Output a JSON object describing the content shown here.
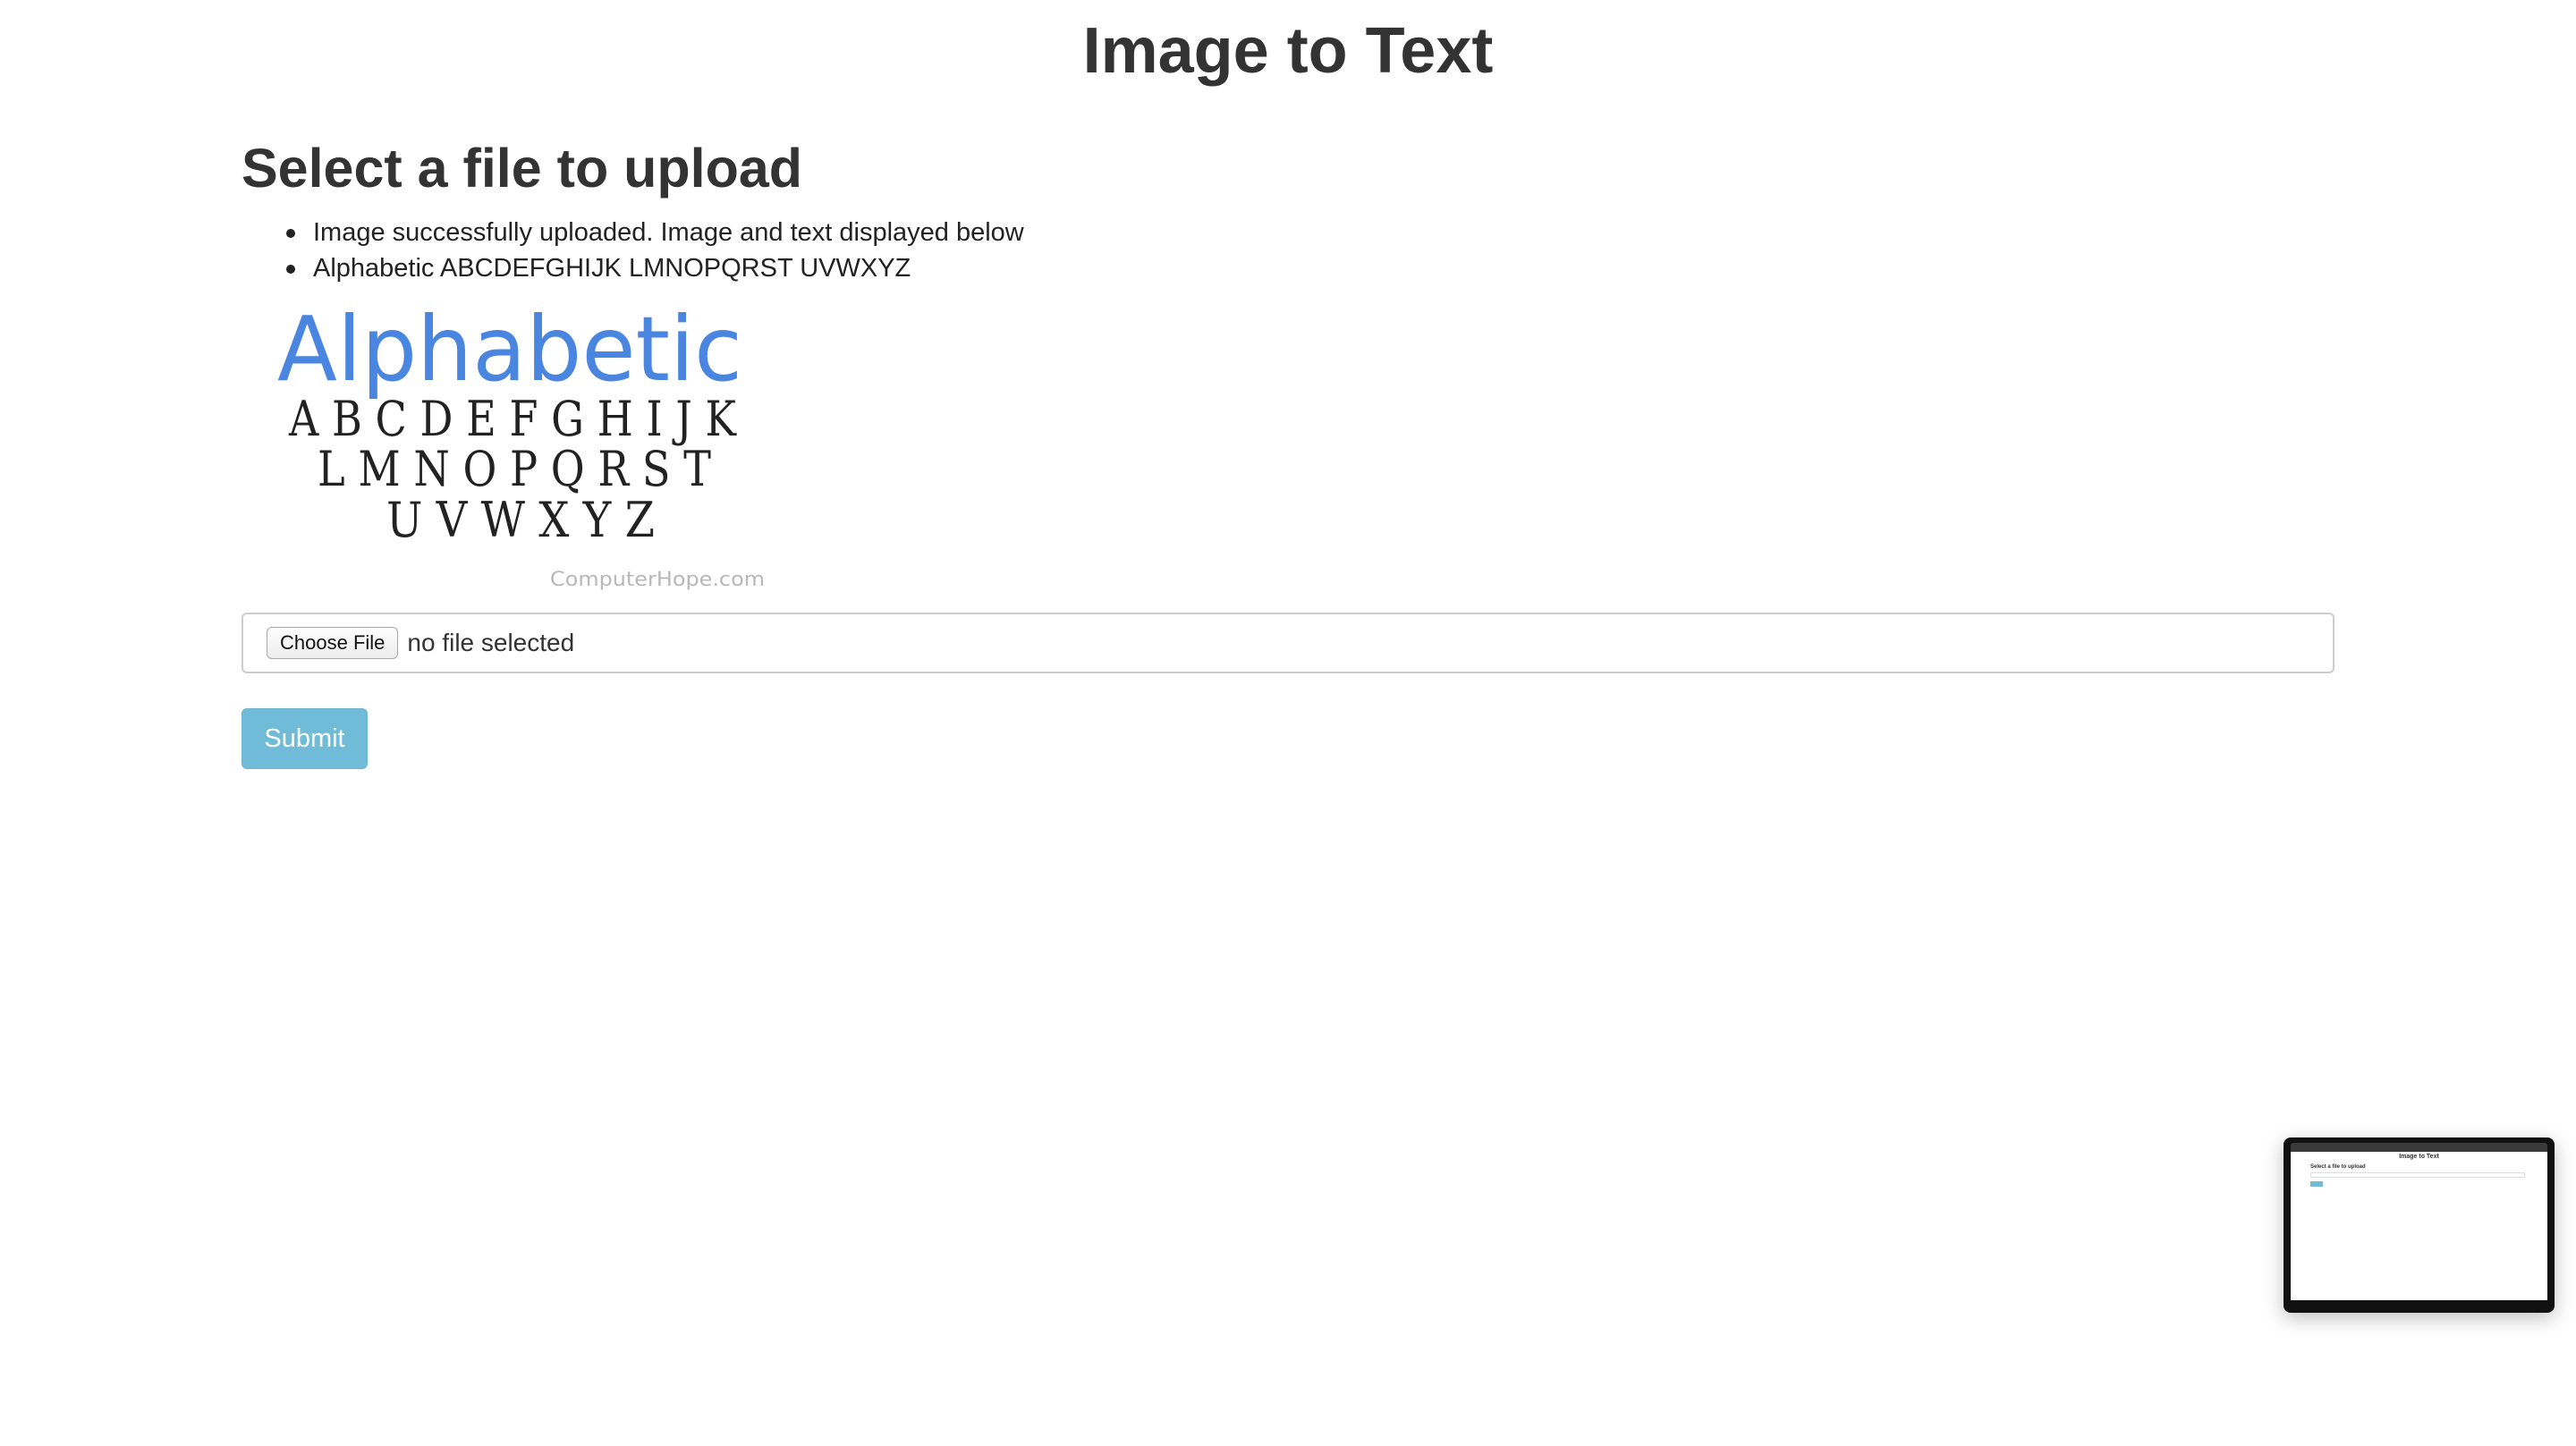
{
  "page": {
    "title": "Image to Text"
  },
  "upload_form": {
    "heading": "Select a file to upload",
    "messages": [
      "Image successfully uploaded. Image and text displayed below",
      "Alphabetic ABCDEFGHIJK LMNOPQRST UVWXYZ"
    ],
    "file_input": {
      "button_label": "Choose File",
      "status": "no file selected"
    },
    "submit_label": "Submit"
  },
  "uploaded_image": {
    "title_text": "Alphabetic",
    "line1": "A B C D E F G H I J K",
    "line2": "L M N O P Q R S T",
    "line3": "U V W X Y Z",
    "watermark": "ComputerHope.com",
    "title_color": "#4a86e0"
  },
  "preview_thumbnail": {
    "title": "Image to Text",
    "heading": "Select a file to upload"
  },
  "colors": {
    "text": "#333333",
    "submit_bg": "#6fbbd8",
    "input_border": "#cccccc"
  }
}
